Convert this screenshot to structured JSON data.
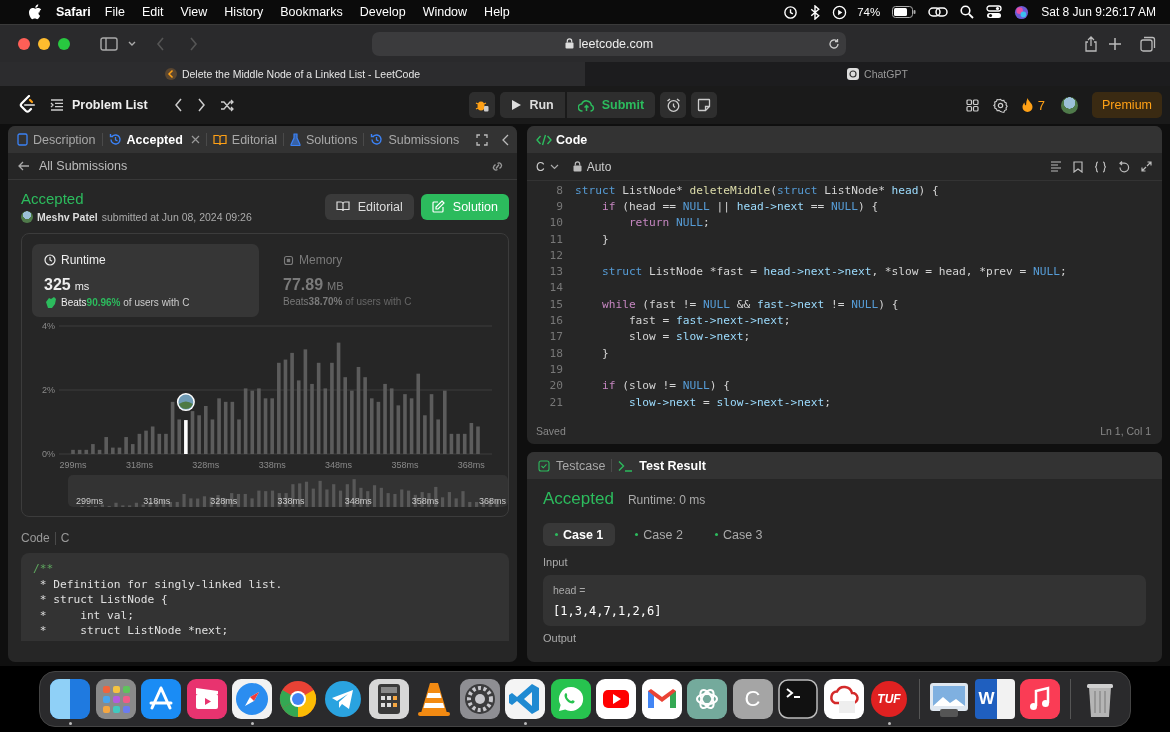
{
  "menu_bar": {
    "app": "Safari",
    "menus": [
      "File",
      "Edit",
      "View",
      "History",
      "Bookmarks",
      "Develop",
      "Window",
      "Help"
    ],
    "battery": "74%",
    "clock": "Sat 8 Jun  9:26:17 AM"
  },
  "browser": {
    "address": "leetcode.com",
    "tabs": [
      {
        "title": "Delete the Middle Node of a Linked List - LeetCode",
        "selected": true
      },
      {
        "title": "ChatGPT",
        "selected": false
      }
    ]
  },
  "nav": {
    "problem_list": "Problem List",
    "run": "Run",
    "submit": "Submit",
    "streak": "7",
    "premium": "Premium"
  },
  "left_panel": {
    "tabs": [
      {
        "label": "Description",
        "kind": "description",
        "selected": false,
        "closable": false
      },
      {
        "label": "Accepted",
        "kind": "history",
        "selected": true,
        "closable": true
      },
      {
        "label": "Editorial",
        "kind": "book",
        "selected": false,
        "closable": false
      },
      {
        "label": "Solutions",
        "kind": "flask",
        "selected": false,
        "closable": false
      },
      {
        "label": "Submissions",
        "kind": "history",
        "selected": false,
        "closable": false
      }
    ],
    "back": "All Submissions",
    "submission": {
      "status": "Accepted",
      "author": "Meshv Patel",
      "submitted": "submitted at Jun 08, 2024 09:26",
      "editorial": "Editorial",
      "solution": "Solution"
    },
    "stats": [
      {
        "kind": "runtime",
        "label": "Runtime",
        "value": "325",
        "unit": "ms",
        "beats": "Beats",
        "percent": "90.96%",
        "suffix": "of users with C",
        "selected": true
      },
      {
        "kind": "memory",
        "label": "Memory",
        "value": "77.89",
        "unit": "MB",
        "beats": "Beats",
        "percent": "38.70%",
        "suffix": "of users with C",
        "selected": false
      }
    ],
    "chart_data": {
      "type": "bar",
      "categories": [
        "299ms",
        null,
        null,
        null,
        null,
        null,
        null,
        null,
        null,
        null,
        "318ms",
        null,
        null,
        null,
        null,
        null,
        null,
        null,
        null,
        null,
        "328ms",
        null,
        null,
        null,
        null,
        null,
        null,
        null,
        null,
        null,
        "338ms",
        null,
        null,
        null,
        null,
        null,
        null,
        null,
        null,
        null,
        "348ms",
        null,
        null,
        null,
        null,
        null,
        null,
        null,
        null,
        null,
        "358ms",
        null,
        null,
        null,
        null,
        null,
        null,
        null,
        null,
        null,
        "368ms",
        null
      ],
      "series": [
        {
          "color": "#5c5c5c",
          "values": [
            0.13,
            0.13,
            0.13,
            0.31,
            0.13,
            0.53,
            0.2,
            0.2,
            0.53,
            0.31,
            0.63,
            0.73,
            0.86,
            0.63,
            0.63,
            1.63,
            1.08,
            null,
            1.34,
            1.21,
            1.5,
            1.08,
            1.74,
            1.63,
            1.63,
            1.08,
            2.05,
            1.98,
            2.05,
            1.74,
            1.74,
            2.85,
            2.95,
            3.16,
            2.3,
            3.27,
            2.19,
            2.85,
            2.05,
            2.85,
            3.48,
            2.4,
            1.98,
            2.72,
            2.4,
            1.74,
            1.63,
            2.19,
            2.05,
            1.52,
            1.87,
            1.74,
            2.51,
            1.21,
            1.87,
            1.08,
            1.98,
            0.63,
            0.63,
            0.63,
            0.97,
            0.86
          ]
        },
        {
          "color": "#ffffff",
          "values": [
            null,
            null,
            null,
            null,
            null,
            null,
            null,
            null,
            null,
            null,
            null,
            null,
            null,
            null,
            null,
            null,
            null,
            1.06,
            null,
            null,
            null,
            null,
            null,
            null,
            null,
            null,
            null,
            null,
            null,
            null,
            null,
            null,
            null,
            null,
            null,
            null,
            null,
            null,
            null,
            null,
            null,
            null,
            null,
            null,
            null,
            null,
            null,
            null,
            null,
            null,
            null,
            null,
            null,
            null,
            null,
            null,
            null,
            null,
            null,
            null,
            null,
            null
          ]
        }
      ],
      "ylim": [
        0,
        4
      ],
      "yticks": [
        {
          "value": 0,
          "label": "0%"
        },
        {
          "value": 2,
          "label": "2%"
        },
        {
          "value": 4,
          "label": "4%"
        }
      ]
    },
    "navigator": {
      "labels": [
        "299ms",
        "318ms",
        "328ms",
        "338ms",
        "348ms",
        "358ms",
        "368ms"
      ]
    },
    "code": {
      "label": "Code",
      "language": "C",
      "lines": [
        {
          "text": "/**",
          "kind": "comment"
        },
        {
          "text": " * Definition for singly-linked list.",
          "kind": "text"
        },
        {
          "text": " * struct ListNode {",
          "kind": "text"
        },
        {
          "text": " *     int val;",
          "kind": "text"
        },
        {
          "text": " *     struct ListNode *next;",
          "kind": "text"
        }
      ]
    }
  },
  "editor": {
    "title": "Code",
    "language": "C",
    "mode": "Auto",
    "lines": [
      {
        "n": "8",
        "tokens": [
          {
            "text": "struct",
            "kind": "keyword"
          },
          {
            "text": " ListNode* ",
            "kind": "plain"
          },
          {
            "text": "deleteMiddle",
            "kind": "function"
          },
          {
            "text": "(",
            "kind": "plain"
          },
          {
            "text": "struct",
            "kind": "keyword"
          },
          {
            "text": " ListNode* ",
            "kind": "plain"
          },
          {
            "text": "head",
            "kind": "variable"
          },
          {
            "text": ") {",
            "kind": "plain"
          }
        ]
      },
      {
        "n": "9",
        "tokens": [
          {
            "text": "    if",
            "kind": "control"
          },
          {
            "text": " (head == ",
            "kind": "plain"
          },
          {
            "text": "NULL",
            "kind": "constant"
          },
          {
            "text": " || ",
            "kind": "plain"
          },
          {
            "text": "head->next",
            "kind": "variable"
          },
          {
            "text": " == ",
            "kind": "plain"
          },
          {
            "text": "NULL",
            "kind": "constant"
          },
          {
            "text": ") {",
            "kind": "plain"
          }
        ]
      },
      {
        "n": "10",
        "tokens": [
          {
            "text": "        return",
            "kind": "control"
          },
          {
            "text": " NULL",
            "kind": "constant"
          },
          {
            "text": ";",
            "kind": "plain"
          }
        ]
      },
      {
        "n": "11",
        "tokens": [
          {
            "text": "    }",
            "kind": "plain"
          }
        ]
      },
      {
        "n": "12"
      },
      {
        "n": "13",
        "tokens": [
          {
            "text": "    struct",
            "kind": "keyword"
          },
          {
            "text": " ListNode *fast = ",
            "kind": "plain"
          },
          {
            "text": "head->next->next",
            "kind": "variable"
          },
          {
            "text": ", *slow = head, *prev = ",
            "kind": "plain"
          },
          {
            "text": "NULL",
            "kind": "constant"
          },
          {
            "text": ";",
            "kind": "plain"
          }
        ]
      },
      {
        "n": "14"
      },
      {
        "n": "15",
        "tokens": [
          {
            "text": "    while",
            "kind": "control"
          },
          {
            "text": " (fast != ",
            "kind": "plain"
          },
          {
            "text": "NULL",
            "kind": "constant"
          },
          {
            "text": " && ",
            "kind": "plain"
          },
          {
            "text": "fast->next",
            "kind": "variable"
          },
          {
            "text": " != ",
            "kind": "plain"
          },
          {
            "text": "NULL",
            "kind": "constant"
          },
          {
            "text": ") {",
            "kind": "plain"
          }
        ]
      },
      {
        "n": "16",
        "tokens": [
          {
            "text": "        fast = ",
            "kind": "plain"
          },
          {
            "text": "fast->next->next",
            "kind": "variable"
          },
          {
            "text": ";",
            "kind": "plain"
          }
        ]
      },
      {
        "n": "17",
        "tokens": [
          {
            "text": "        slow = ",
            "kind": "plain"
          },
          {
            "text": "slow->next",
            "kind": "variable"
          },
          {
            "text": ";",
            "kind": "plain"
          }
        ]
      },
      {
        "n": "18",
        "tokens": [
          {
            "text": "    }",
            "kind": "plain"
          }
        ]
      },
      {
        "n": "19"
      },
      {
        "n": "20",
        "tokens": [
          {
            "text": "    if",
            "kind": "control"
          },
          {
            "text": " (slow != ",
            "kind": "plain"
          },
          {
            "text": "NULL",
            "kind": "constant"
          },
          {
            "text": ") {",
            "kind": "plain"
          }
        ]
      },
      {
        "n": "21",
        "tokens": [
          {
            "text": "        slow->next",
            "kind": "variable"
          },
          {
            "text": " = ",
            "kind": "plain"
          },
          {
            "text": "slow->next->next",
            "kind": "variable"
          },
          {
            "text": ";",
            "kind": "plain"
          }
        ]
      }
    ],
    "status": "Saved",
    "cursor": "Ln 1, Col 1"
  },
  "console": {
    "tabs": [
      {
        "label": "Testcase",
        "kind": "testcase",
        "selected": false
      },
      {
        "label": "Test Result",
        "kind": "result",
        "selected": true
      }
    ],
    "result": "Accepted",
    "runtime": "Runtime: 0 ms",
    "cases": [
      {
        "label": "Case 1",
        "selected": true
      },
      {
        "label": "Case 2",
        "selected": false
      },
      {
        "label": "Case 3",
        "selected": false
      }
    ],
    "input_label": "Input",
    "variable": "head =",
    "value": "[1,3,4,7,1,2,6]",
    "output_label": "Output"
  },
  "dock": [
    {
      "kind": "finder",
      "running": true
    },
    {
      "kind": "launchpad",
      "running": false
    },
    {
      "kind": "appstore",
      "running": false
    },
    {
      "kind": "clips",
      "running": false
    },
    {
      "kind": "safari",
      "running": true
    },
    {
      "kind": "chrome",
      "running": false
    },
    {
      "kind": "telegram",
      "running": false
    },
    {
      "kind": "calculator",
      "running": false
    },
    {
      "kind": "vlc",
      "running": false
    },
    {
      "kind": "settings",
      "running": false
    },
    {
      "kind": "vscode",
      "running": true
    },
    {
      "kind": "whatsapp",
      "running": false
    },
    {
      "kind": "youtube",
      "running": false
    },
    {
      "kind": "gmail",
      "running": false
    },
    {
      "kind": "chatgpt",
      "running": false
    },
    {
      "kind": "letter",
      "label": "C",
      "running": false
    },
    {
      "kind": "terminal",
      "running": false
    },
    {
      "kind": "cloud",
      "running": false
    },
    {
      "kind": "badge",
      "label": "TUF",
      "running": true
    },
    {
      "kind": "separator"
    },
    {
      "kind": "preview",
      "running": false
    },
    {
      "kind": "doc",
      "label": "W",
      "running": false
    },
    {
      "kind": "music",
      "running": false
    },
    {
      "kind": "separator"
    },
    {
      "kind": "trash",
      "running": false
    }
  ]
}
